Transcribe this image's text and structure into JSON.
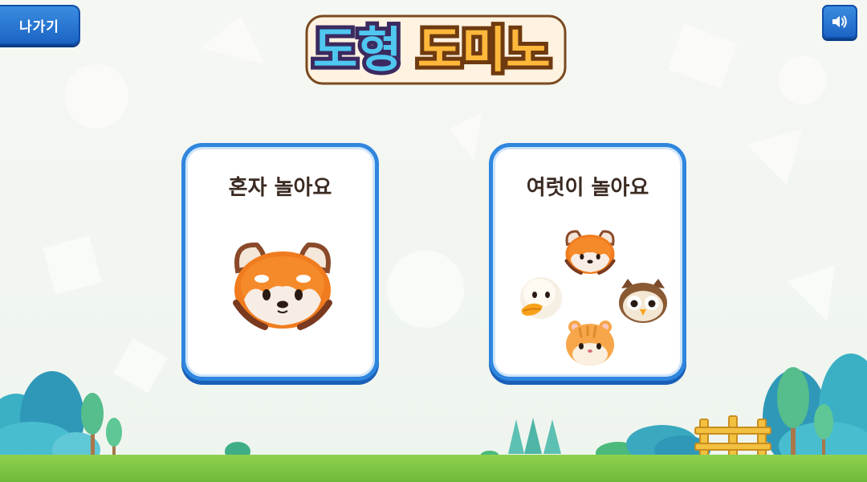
{
  "header": {
    "exit_label": "나가기",
    "sound_icon": "speaker-icon"
  },
  "title": {
    "part1": "도형",
    "part2": "도미노"
  },
  "modes": [
    {
      "label": "혼자 놀아요",
      "animals": [
        "red-panda"
      ]
    },
    {
      "label": "여럿이 놀아요",
      "animals": [
        "red-panda",
        "duck",
        "owl",
        "hamster"
      ]
    }
  ],
  "colors": {
    "button_blue": "#1c63c4",
    "card_border": "#2f86de",
    "grass": "#8ed14e",
    "title_blue": "#4fc7f0",
    "title_orange": "#ffb83b"
  }
}
